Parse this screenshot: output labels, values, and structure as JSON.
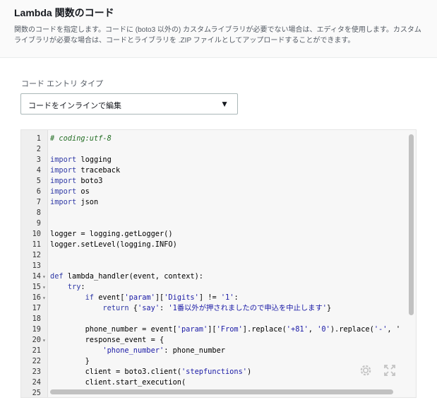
{
  "header": {
    "title": "Lambda 関数のコード",
    "description": "関数のコードを指定します。コードに (boto3 以外の) カスタムライブラリが必要でない場合は、エディタを使用します。カスタムライブラリが必要な場合は、コードとライブラリを .ZIP ファイルとしてアップロードすることができます。"
  },
  "code_entry": {
    "label": "コード エントリ タイプ",
    "selected": "コードをインラインで編集",
    "caret": "▼"
  },
  "editor": {
    "lines": [
      {
        "n": "1",
        "fold": "",
        "text": "# coding:utf-8"
      },
      {
        "n": "2",
        "fold": "",
        "text": ""
      },
      {
        "n": "3",
        "fold": "",
        "text": "import logging"
      },
      {
        "n": "4",
        "fold": "",
        "text": "import traceback"
      },
      {
        "n": "5",
        "fold": "",
        "text": "import boto3"
      },
      {
        "n": "6",
        "fold": "",
        "text": "import os"
      },
      {
        "n": "7",
        "fold": "",
        "text": "import json"
      },
      {
        "n": "8",
        "fold": "",
        "text": ""
      },
      {
        "n": "9",
        "fold": "",
        "text": ""
      },
      {
        "n": "10",
        "fold": "",
        "text": "logger = logging.getLogger()"
      },
      {
        "n": "11",
        "fold": "",
        "text": "logger.setLevel(logging.INFO)"
      },
      {
        "n": "12",
        "fold": "",
        "text": ""
      },
      {
        "n": "13",
        "fold": "",
        "text": ""
      },
      {
        "n": "14",
        "fold": "▾",
        "text": "def lambda_handler(event, context):"
      },
      {
        "n": "15",
        "fold": "▾",
        "text": "    try:"
      },
      {
        "n": "16",
        "fold": "▾",
        "text": "        if event['param']['Digits'] != '1':"
      },
      {
        "n": "17",
        "fold": "",
        "text": "            return {'say': '1番以外が押されましたので申込を中止します'}"
      },
      {
        "n": "18",
        "fold": "",
        "text": ""
      },
      {
        "n": "19",
        "fold": "",
        "text": "        phone_number = event['param']['From'].replace('+81', '0').replace('-', '"
      },
      {
        "n": "20",
        "fold": "▾",
        "text": "        response_event = {"
      },
      {
        "n": "21",
        "fold": "",
        "text": "            'phone_number': phone_number"
      },
      {
        "n": "22",
        "fold": "",
        "text": "        }"
      },
      {
        "n": "23",
        "fold": "",
        "text": "        client = boto3.client('stepfunctions')"
      },
      {
        "n": "24",
        "fold": "",
        "text": "        client.start_execution("
      },
      {
        "n": "25",
        "fold": "",
        "text": ""
      }
    ]
  },
  "icons": {
    "settings": "gear-icon",
    "fullscreen": "expand-icon"
  }
}
